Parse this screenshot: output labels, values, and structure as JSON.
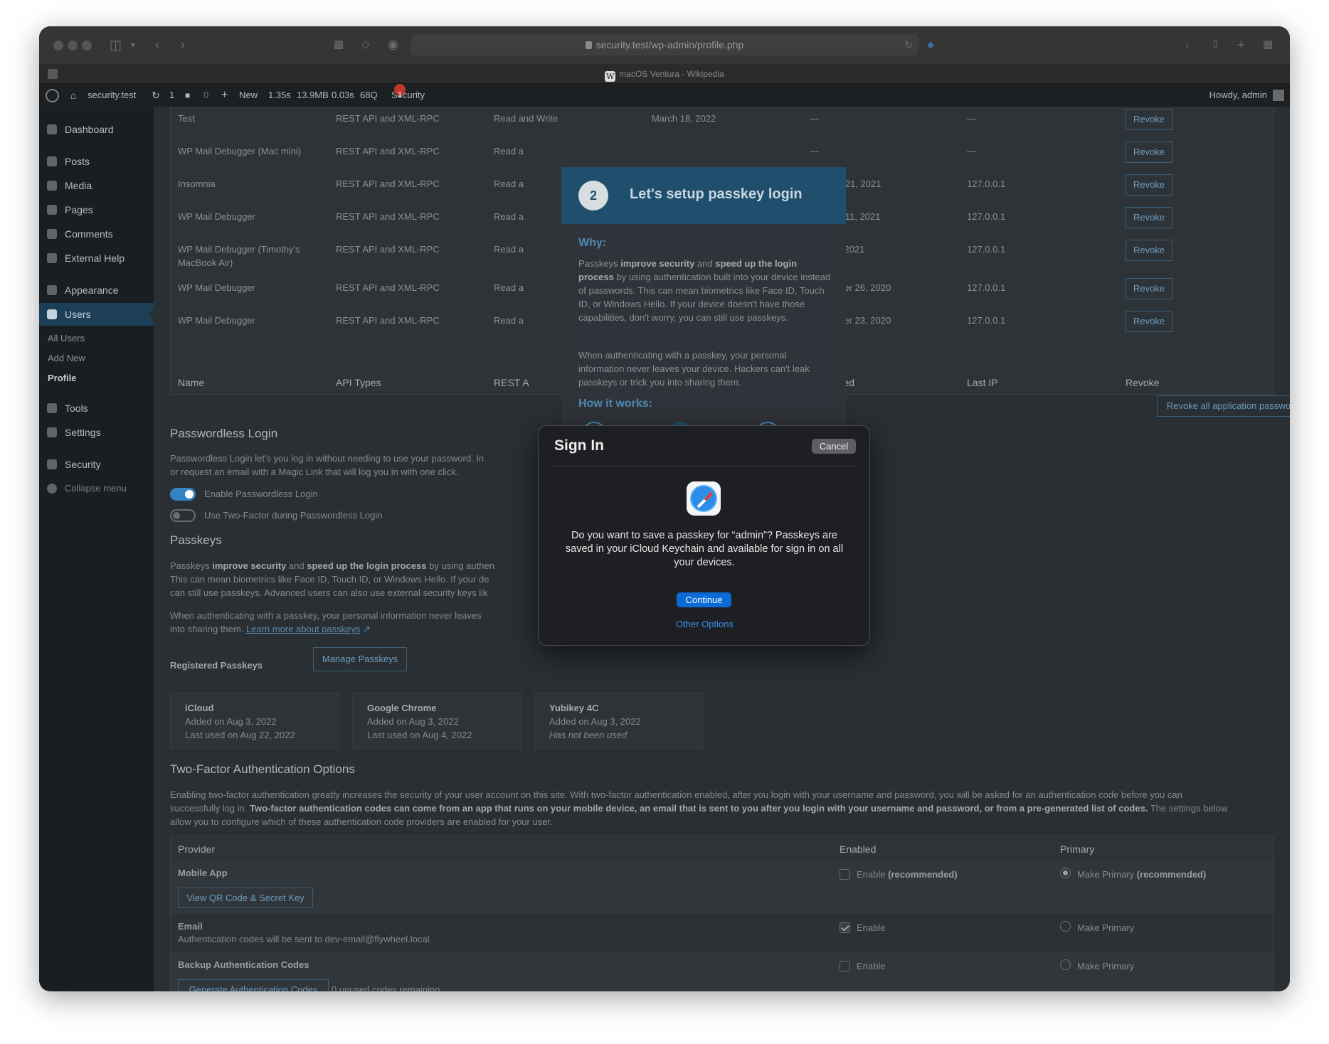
{
  "browser": {
    "url": "security.test/wp-admin/profile.php",
    "tab_title": "macOS Ventura - Wikipedia",
    "tab_glyph": "W"
  },
  "adminbar": {
    "site_name": "security.test",
    "updates_count": "1",
    "comments_count": "0",
    "new_label": "New",
    "perf_time": "1.35s",
    "perf_memory": "13.9MB",
    "perf_query_time": "0.03s",
    "perf_queries": "68Q",
    "security_label": "Security",
    "security_badge": "1",
    "howdy": "Howdy, admin"
  },
  "sidebar": {
    "items": [
      {
        "label": "Dashboard"
      },
      {
        "label": "Posts"
      },
      {
        "label": "Media"
      },
      {
        "label": "Pages"
      },
      {
        "label": "Comments"
      },
      {
        "label": "External Help"
      },
      {
        "label": "Appearance"
      },
      {
        "label": "Users"
      },
      {
        "label": "Tools"
      },
      {
        "label": "Settings"
      },
      {
        "label": "Security"
      },
      {
        "label": "Collapse menu"
      }
    ],
    "submenu": [
      "All Users",
      "Add New",
      "Profile"
    ]
  },
  "app_passwords": {
    "rows": [
      {
        "name": "Test",
        "api": "REST API and XML-RPC",
        "perm": "Read and Write",
        "created": "March 18, 2022",
        "last_used": "—",
        "last_ip": "—"
      },
      {
        "name": "WP Mail Debugger (Mac mini)",
        "api": "REST API and XML-RPC",
        "perm": "Read a",
        "created": "",
        "last_used": "—",
        "last_ip": "—"
      },
      {
        "name": "Insomnia",
        "api": "REST API and XML-RPC",
        "perm": "Read a",
        "created": "",
        "last_used": "October 21, 2021",
        "last_ip": "127.0.0.1"
      },
      {
        "name": "WP Mail Debugger",
        "api": "REST API and XML-RPC",
        "perm": "Read a",
        "created": "",
        "last_used": "January 11, 2021",
        "last_ip": "127.0.0.1"
      },
      {
        "name": "WP Mail Debugger (Timothy's",
        "name2": "MacBook Air)",
        "api": "REST API and XML-RPC",
        "perm": "Read a",
        "created": "",
        "last_used": "July 23, 2021",
        "last_ip": "127.0.0.1"
      },
      {
        "name": "WP Mail Debugger",
        "api": "REST API and XML-RPC",
        "perm": "Read a",
        "created": "",
        "last_used": "December 26, 2020",
        "last_ip": "127.0.0.1"
      },
      {
        "name": "WP Mail Debugger",
        "api": "REST API and XML-RPC",
        "perm": "Read a",
        "created": "",
        "last_used": "December 23, 2020",
        "last_ip": "127.0.0.1"
      }
    ],
    "revoke_label": "Revoke",
    "footer": {
      "name": "Name",
      "api": "API Types",
      "perm": "REST A",
      "last_used": "Last Used",
      "last_ip": "Last IP",
      "revoke": "Revoke"
    },
    "revoke_all": "Revoke all application passwords"
  },
  "passwordless": {
    "title": "Passwordless Login",
    "desc1": "Passwordless Login let's you log in without needing to use your password. In",
    "desc2": "or request an email with a Magic Link that will log you in with one click.",
    "toggle1": "Enable Passwordless Login",
    "toggle2": "Use Two-Factor during Passwordless Login"
  },
  "passkeys": {
    "title": "Passkeys",
    "p1_a": "Passkeys ",
    "p1_b": "improve security",
    "p1_c": " and ",
    "p1_d": "speed up the login process",
    "p1_e": " by using authen",
    "p1_line2": "This can mean biometrics like Face ID, Touch ID, or Windows Hello. If your de",
    "p1_line3": "can still use passkeys. Advanced users can also use external security keys lik",
    "p2_line1": "When authenticating with a passkey, your personal information never leaves",
    "p2_line2": "into sharing them. ",
    "learn_more": "Learn more about passkeys",
    "registered_label": "Registered Passkeys",
    "manage_btn": "Manage Passkeys",
    "cards": [
      {
        "name": "iCloud",
        "added": "Added on Aug 3, 2022",
        "used": "Last used on Aug 22, 2022"
      },
      {
        "name": "Google Chrome",
        "added": "Added on Aug 3, 2022",
        "used": "Last used on Aug 4, 2022"
      },
      {
        "name": "Yubikey 4C",
        "added": "Added on Aug 3, 2022",
        "used": "Has not been used"
      }
    ]
  },
  "twofactor": {
    "title": "Two-Factor Authentication Options",
    "desc_line1": "Enabling two-factor authentication greatly increases the security of your user account on this site. With two-factor authentication enabled, after you login with your username and password, you will be asked for an authentication code before you can",
    "desc_line2_a": "successfully log in. ",
    "desc_line2_b": "Two-factor authentication codes can come from an app that runs on your mobile device, an email that is sent to you after you login with your username and password, or from a pre-generated list of codes.",
    "desc_line2_c": " The settings below",
    "desc_line3": "allow you to configure which of these authentication code providers are enabled for your user.",
    "headers": {
      "provider": "Provider",
      "enabled": "Enabled",
      "primary": "Primary"
    },
    "mobile": {
      "name": "Mobile App",
      "btn": "View QR Code & Secret Key",
      "enable": "Enable ",
      "enable_b": "(recommended)",
      "primary": "Make Primary ",
      "primary_b": "(recommended)"
    },
    "email": {
      "name": "Email",
      "desc": "Authentication codes will be sent to dev-email@flywheel.local.",
      "enable": "Enable",
      "primary": "Make Primary"
    },
    "backup": {
      "name": "Backup Authentication Codes",
      "btn": "Generate Authentication Codes",
      "remaining": "0 unused codes remaining.",
      "enable": "Enable",
      "primary": "Make Primary"
    }
  },
  "wizard": {
    "step": "2",
    "title": "Let's setup passkey login",
    "why": "Why:",
    "p1_a": "Passkeys ",
    "p1_b": "improve security",
    "p1_c": " and ",
    "p1_d": "speed up the login",
    "p1_e": "process",
    "p1_f": " by using authentication built into your device instead of passwords. This can mean biometrics like Face ID, Touch ID, or Windows Hello. If your device doesn't have those capabilities, don't worry, you can still use passkeys.",
    "p2": "When authenticating with a passkey, your personal information never leaves your device. Hackers can't leak passkeys or trick you into sharing them.",
    "how": "How it works:"
  },
  "signin": {
    "title": "Sign In",
    "cancel": "Cancel",
    "message": "Do you want to save a passkey for “admin”? Passkeys are saved in your iCloud Keychain and available for sign in on all your devices.",
    "continue": "Continue",
    "other": "Other Options"
  }
}
